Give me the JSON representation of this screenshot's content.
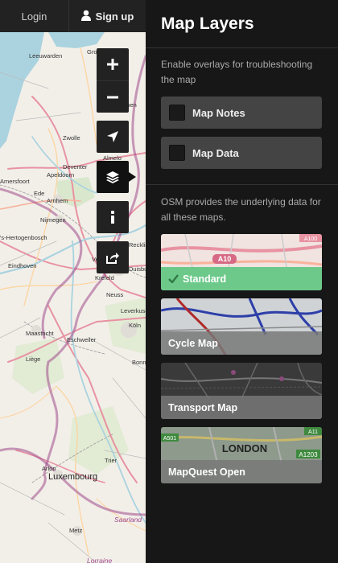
{
  "topbar": {
    "login_label": "Login",
    "signup_label": "Sign up",
    "user_icon": "user-icon"
  },
  "controls": {
    "zoom_in": "plus-icon",
    "zoom_out": "minus-icon",
    "locate": "location-arrow-icon",
    "layers": "layers-icon",
    "info": "info-icon",
    "share": "share-icon"
  },
  "map": {
    "cities": [
      {
        "name": "Groningen"
      },
      {
        "name": "Leeuwarden"
      },
      {
        "name": "Emmen"
      },
      {
        "name": "Zwolle"
      },
      {
        "name": "Almelo"
      },
      {
        "name": "Deventer"
      },
      {
        "name": "Apeldoorn"
      },
      {
        "name": "Amersfoort"
      },
      {
        "name": "Ede"
      },
      {
        "name": "Arnhem"
      },
      {
        "name": "Nijmegen"
      },
      {
        "name": "'s-Hertogenbosch"
      },
      {
        "name": "Eindhoven"
      },
      {
        "name": "Venlo"
      },
      {
        "name": "Krefeld"
      },
      {
        "name": "Neuss"
      },
      {
        "name": "Duisburg"
      },
      {
        "name": "Recklinghausen"
      },
      {
        "name": "Leverkusen"
      },
      {
        "name": "Köln"
      },
      {
        "name": "Maastricht"
      },
      {
        "name": "Eschweiler"
      },
      {
        "name": "Liège"
      },
      {
        "name": "Bonn"
      },
      {
        "name": "Arlon"
      },
      {
        "name": "Luxembourg"
      },
      {
        "name": "Trier"
      },
      {
        "name": "Metz"
      },
      {
        "name": "Saarland"
      },
      {
        "name": "Lorraine"
      }
    ]
  },
  "panel": {
    "title": "Map Layers",
    "overlays_intro": "Enable overlays for troubleshooting the map",
    "overlays": [
      {
        "label": "Map Notes",
        "checked": false
      },
      {
        "label": "Map Data",
        "checked": false
      }
    ],
    "layers_intro": "OSM provides the underlying data for all these maps.",
    "layers": [
      {
        "label": "Standard",
        "selected": true,
        "check_icon": "checkmark-icon",
        "thumb_road_label": "A10",
        "thumb_extra": "A100"
      },
      {
        "label": "Cycle Map",
        "selected": false
      },
      {
        "label": "Transport Map",
        "selected": false
      },
      {
        "label": "MapQuest Open",
        "selected": false,
        "thumb_city": "LONDON",
        "thumb_road_a": "A501",
        "thumb_road_b": "A1203",
        "thumb_road_c": "A11"
      }
    ]
  },
  "colors": {
    "panel_bg": "#171717",
    "item_bg": "#444444",
    "selected_green": "#6dc98a",
    "map_bg": "#f2efe9",
    "border_purple": "#a04a8a"
  }
}
